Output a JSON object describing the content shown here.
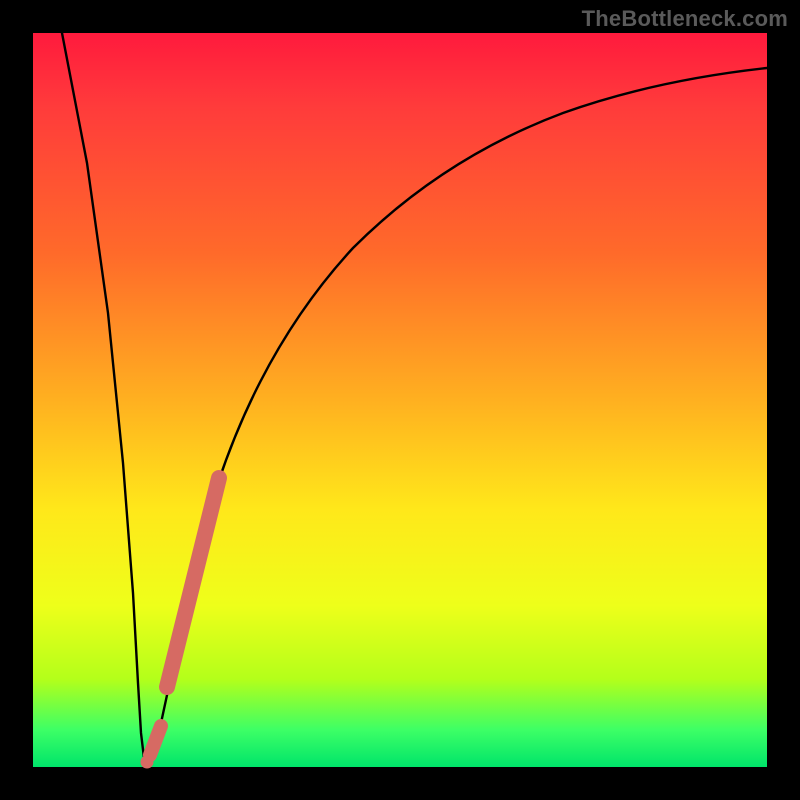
{
  "watermark": "TheBottleneck.com",
  "chart_data": {
    "type": "line",
    "title": "",
    "xlabel": "",
    "ylabel": "",
    "xlim": [
      0,
      100
    ],
    "ylim": [
      0,
      100
    ],
    "grid": false,
    "legend": false,
    "annotations": [
      {
        "text": "TheBottleneck.com",
        "pos": "top-right"
      }
    ],
    "series": [
      {
        "name": "bottleneck-curve",
        "color": "#000000",
        "x": [
          4,
          6,
          8,
          10,
          12,
          13,
          14,
          15,
          16,
          18,
          20,
          22,
          25,
          28,
          32,
          36,
          40,
          45,
          50,
          55,
          60,
          65,
          70,
          75,
          80,
          85,
          90,
          95,
          100
        ],
        "y": [
          100,
          80,
          60,
          40,
          20,
          8,
          1,
          4,
          12,
          28,
          40,
          50,
          58,
          64,
          70,
          75,
          79,
          82,
          85,
          87,
          89,
          90.5,
          91.5,
          92.5,
          93.3,
          94,
          94.6,
          95,
          95.3
        ]
      },
      {
        "name": "highlight-segment",
        "color": "#d66a63",
        "thick": true,
        "x": [
          14.0,
          15.0,
          16.5,
          19.0,
          24.0
        ],
        "y": [
          0.8,
          2.0,
          6.0,
          20.0,
          45.0
        ]
      }
    ]
  },
  "colors": {
    "frame": "#000000",
    "curve": "#000000",
    "highlight": "#d66a63",
    "gradient_top": "#ff1a3d",
    "gradient_bottom": "#00e46a"
  }
}
